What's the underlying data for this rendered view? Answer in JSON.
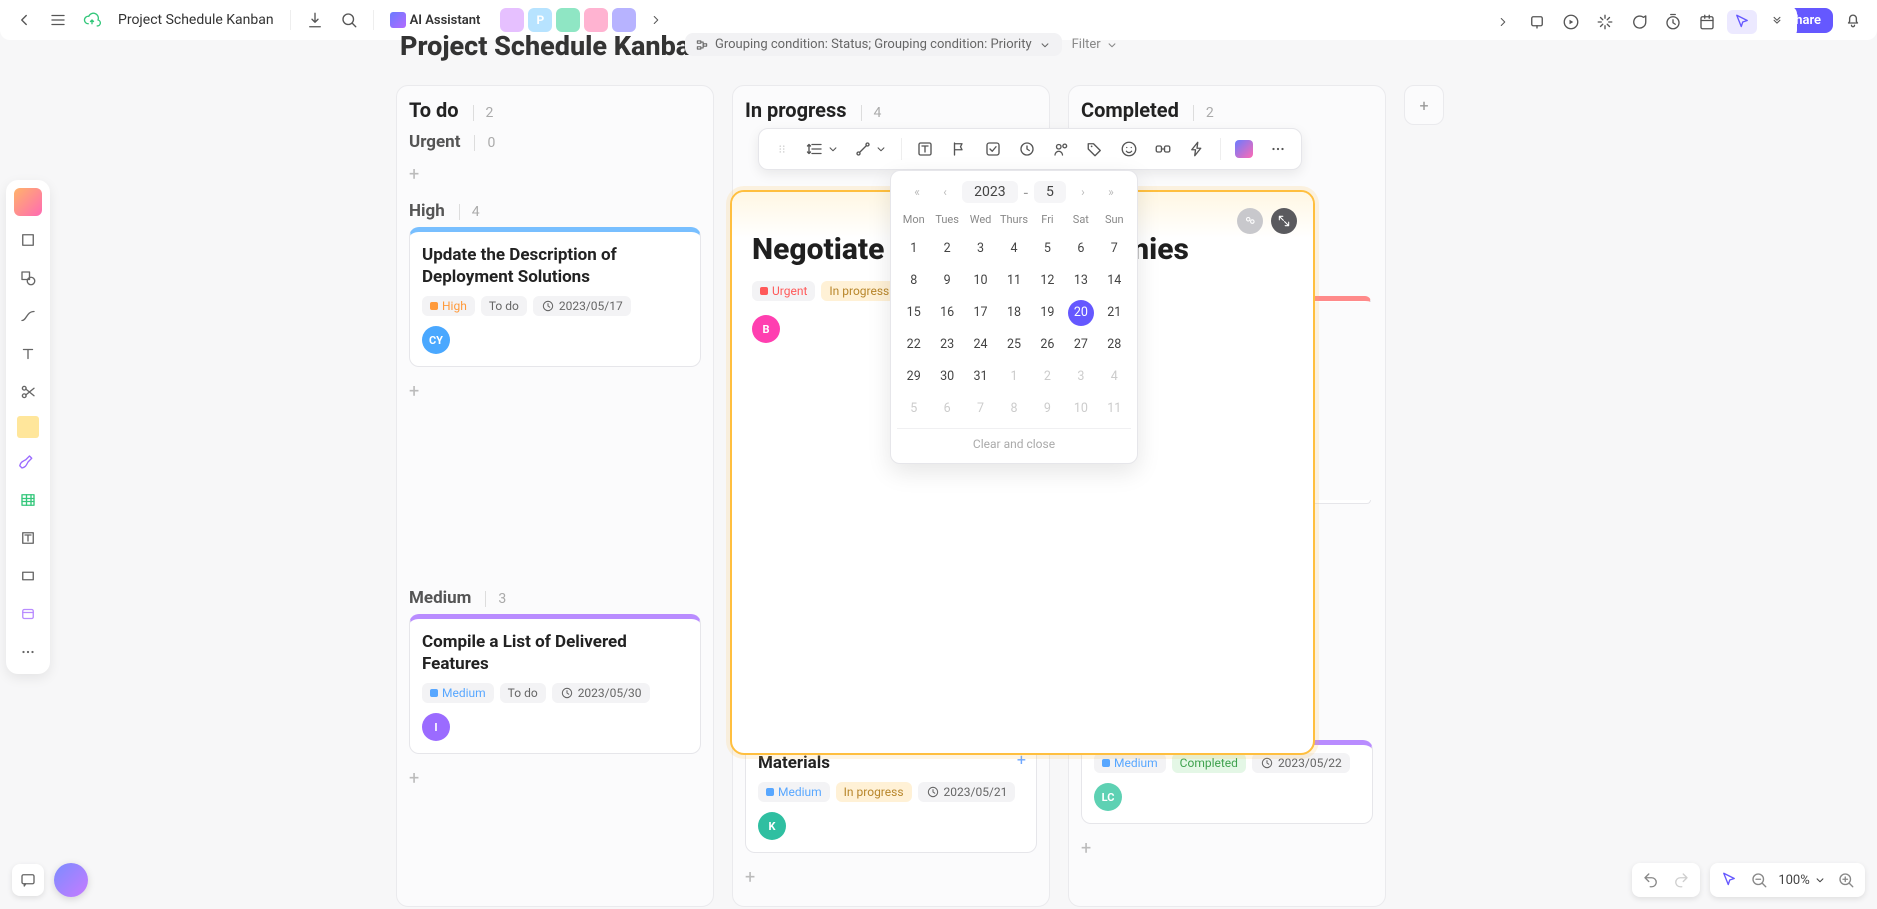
{
  "topbar": {
    "file_title": "Project Schedule Kanban",
    "ai_label": "AI Assistant",
    "share_label": "Share",
    "collaborators": [
      {
        "label": "",
        "bg": "#e6c0ff"
      },
      {
        "label": "P",
        "bg": "#b7e3ff"
      },
      {
        "label": "",
        "bg": "#8fe6c4"
      },
      {
        "label": "",
        "bg": "#ffb3d1"
      },
      {
        "label": "",
        "bg": "#b7b3ff"
      }
    ]
  },
  "board": {
    "title": "Project Schedule Kanban",
    "grouping": "Grouping condition: Status; Grouping condition: Priority",
    "filter_label": "Filter"
  },
  "columns": {
    "todo": {
      "title": "To do",
      "count": "2"
    },
    "inprogress": {
      "title": "In progress",
      "count": "4"
    },
    "completed": {
      "title": "Completed",
      "count": "2"
    }
  },
  "groups": {
    "urgent": {
      "title": "Urgent",
      "count": "0"
    },
    "high": {
      "title": "High",
      "count": "4"
    },
    "medium": {
      "title": "Medium",
      "count": "3"
    }
  },
  "cards": {
    "c1": {
      "title": "Update the Description of Deployment Solutions",
      "priority": "High",
      "status": "To do",
      "date": "2023/05/17",
      "avatar": {
        "text": "CY",
        "bg": "#4aa8ff"
      }
    },
    "c2": {
      "title": "Compile a List of Delivered Features",
      "priority": "Medium",
      "status": "To do",
      "date": "2023/05/30",
      "avatar": {
        "text": "I",
        "bg": "#9b6bff"
      }
    },
    "c3": {
      "title": "Materials",
      "priority": "Medium",
      "status": "In progress",
      "date": "2023/05/21",
      "avatar": {
        "text": "K",
        "bg": "#2fbfa1"
      }
    },
    "c4": {
      "priority": "Medium",
      "status": "Completed",
      "date": "2023/05/22",
      "avatar": {
        "text": "LC",
        "bg": "#5ed1b3"
      }
    },
    "big": {
      "title": "Negotiate",
      "title_suffix": "panies",
      "priority": "Urgent",
      "status": "In progress",
      "avatar": {
        "text": "B",
        "bg": "#ff3fb0"
      }
    }
  },
  "datepicker": {
    "year": "2023",
    "month": "5",
    "dows": [
      "Mon",
      "Tues",
      "Wed",
      "Thurs",
      "Fri",
      "Sat",
      "Sun"
    ],
    "selected": "20",
    "weeks": [
      [
        {
          "n": "1"
        },
        {
          "n": "2"
        },
        {
          "n": "3"
        },
        {
          "n": "4"
        },
        {
          "n": "5"
        },
        {
          "n": "6"
        },
        {
          "n": "7"
        }
      ],
      [
        {
          "n": "8"
        },
        {
          "n": "9"
        },
        {
          "n": "10"
        },
        {
          "n": "11"
        },
        {
          "n": "12"
        },
        {
          "n": "13"
        },
        {
          "n": "14"
        }
      ],
      [
        {
          "n": "15"
        },
        {
          "n": "16"
        },
        {
          "n": "17"
        },
        {
          "n": "18"
        },
        {
          "n": "19"
        },
        {
          "n": "20",
          "sel": true
        },
        {
          "n": "21"
        }
      ],
      [
        {
          "n": "22"
        },
        {
          "n": "23"
        },
        {
          "n": "24"
        },
        {
          "n": "25"
        },
        {
          "n": "26"
        },
        {
          "n": "27"
        },
        {
          "n": "28"
        }
      ],
      [
        {
          "n": "29"
        },
        {
          "n": "30"
        },
        {
          "n": "31"
        },
        {
          "n": "1",
          "o": true
        },
        {
          "n": "2",
          "o": true
        },
        {
          "n": "3",
          "o": true
        },
        {
          "n": "4",
          "o": true
        }
      ],
      [
        {
          "n": "5",
          "o": true
        },
        {
          "n": "6",
          "o": true
        },
        {
          "n": "7",
          "o": true
        },
        {
          "n": "8",
          "o": true
        },
        {
          "n": "9",
          "o": true
        },
        {
          "n": "10",
          "o": true
        },
        {
          "n": "11",
          "o": true
        }
      ]
    ],
    "clear_label": "Clear and close"
  },
  "zoom": {
    "label": "100%"
  }
}
